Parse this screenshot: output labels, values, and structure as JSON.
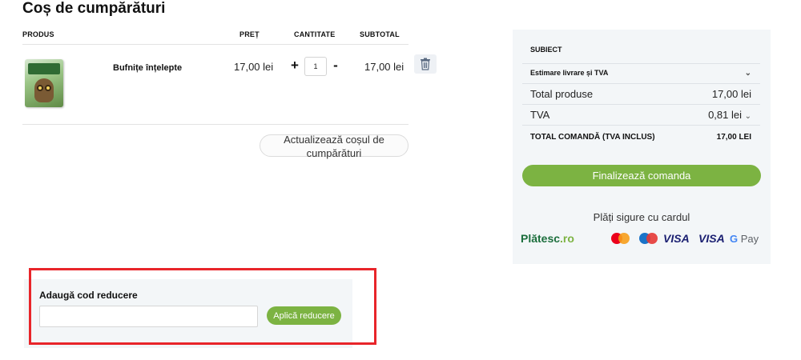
{
  "page": {
    "title": "Coș de cumpărături"
  },
  "cart": {
    "headers": {
      "product": "PRODUS",
      "price": "PREȚ",
      "quantity": "CANTITATE",
      "subtotal": "SUBTOTAL"
    },
    "items": [
      {
        "name": "Bufnițe înțelepte",
        "price": "17,00 lei",
        "quantity": "1",
        "subtotal": "17,00 lei",
        "plus": "+",
        "minus": "-"
      }
    ],
    "update_button": "Actualizează coșul de cumpărături"
  },
  "summary": {
    "heading": "SUBIECT",
    "shipping_estimate": "Estimare livrare și TVA",
    "total_products_label": "Total produse",
    "total_products_value": "17,00 lei",
    "tva_label": "TVA",
    "tva_value": "0,81 lei",
    "order_total_label": "TOTAL COMANDĂ (TVA INCLUS)",
    "order_total_value": "17,00 LEI",
    "checkout_button": "Finalizează comanda",
    "secure_payments": "Plăți sigure cu cardul",
    "payment_logos": {
      "platesc": "Plătesc",
      "platesc_tld": ".ro",
      "visa": "VISA",
      "visa_electron": "VISA",
      "gpay": "Pay",
      "gpay_g": "G"
    }
  },
  "discount": {
    "label": "Adaugă cod reducere",
    "input_value": "",
    "apply_button": "Aplică reducere"
  },
  "colors": {
    "accent": "#7cb342",
    "highlight": "#e8252a",
    "panel": "#f3f6f8"
  }
}
